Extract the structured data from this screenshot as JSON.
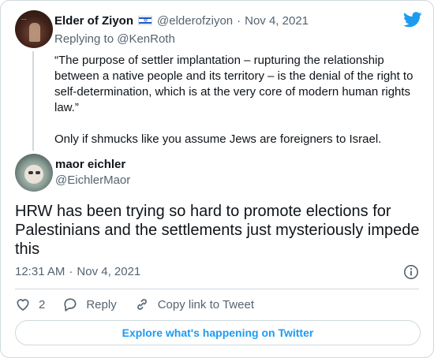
{
  "parent_tweet": {
    "author_name": "Elder of Ziyon",
    "avatar_text": "...",
    "handle": "@elderofziyon",
    "separator": "·",
    "date": "Nov 4, 2021",
    "replying_prefix": "Replying to ",
    "replying_to": "@KenRoth",
    "quote": "“The purpose of settler implantation – rupturing the relationship between a native people and its territory – is the denial of the right to self-determination, which is at the very core of modern human rights law.”",
    "comment": "Only if shmucks like you assume Jews are foreigners to Israel."
  },
  "reply_tweet": {
    "author_name": "maor eichler",
    "handle": "@EichlerMaor",
    "text": "HRW has been trying so hard to promote elections for Palestinians and the settlements just mysteriously impede this",
    "time": "12:31 AM",
    "separator": "·",
    "date": "Nov 4, 2021"
  },
  "actions": {
    "like_count": "2",
    "reply_label": "Reply",
    "copy_link_label": "Copy link to Tweet"
  },
  "explore_button": "Explore what's happening on Twitter",
  "colors": {
    "accent": "#1d9bf0",
    "secondary_text": "#536471",
    "primary_text": "#0f1419",
    "border": "#cfd9de"
  },
  "icons": {
    "brand": "twitter-bird-icon",
    "flag": "israel-flag-icon",
    "info": "info-icon",
    "like": "heart-icon",
    "reply": "reply-bubble-icon",
    "copy": "link-icon"
  }
}
